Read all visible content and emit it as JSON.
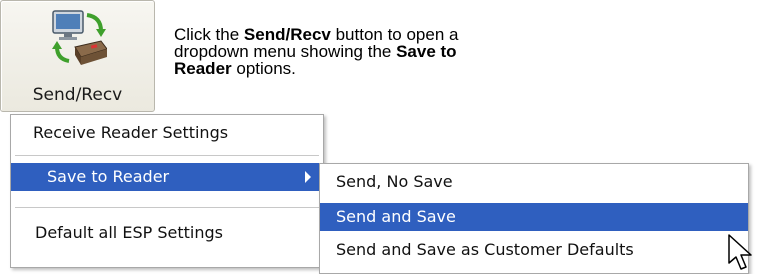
{
  "button": {
    "label": "Send/Recv",
    "icon": "send-receive-icon"
  },
  "instructions": {
    "part1": "Click the ",
    "bold1": "Send/Recv",
    "part2": " button to open a dropdown menu showing the ",
    "bold2": "Save to Reader",
    "part3": " options."
  },
  "menu": {
    "items": [
      {
        "label": "Receive Reader Settings"
      },
      {
        "label": "Save to Reader",
        "highlighted": true,
        "has_submenu": true
      },
      {
        "label": "Default all ESP Settings"
      }
    ]
  },
  "submenu": {
    "items": [
      {
        "label": "Send, No Save"
      },
      {
        "label": "Send and Save",
        "highlighted": true
      },
      {
        "label": "Send and Save as Customer Defaults"
      }
    ]
  },
  "colors": {
    "highlight": "#2f5fbf",
    "highlight_text": "#ffffff"
  }
}
